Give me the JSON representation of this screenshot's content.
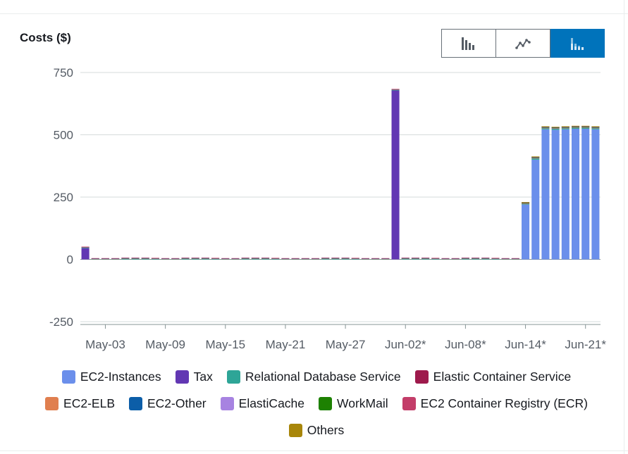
{
  "panel": {
    "title": "Costs ($)",
    "view_buttons": [
      {
        "icon": "bar-chart-icon",
        "active": false
      },
      {
        "icon": "line-chart-icon",
        "active": false
      },
      {
        "icon": "stacked-bar-chart-icon",
        "active": true
      }
    ]
  },
  "chart_data": {
    "type": "bar",
    "stacked": true,
    "title": "",
    "xlabel": "",
    "ylabel": "Costs ($)",
    "ylim": [
      -250,
      750
    ],
    "yticks": [
      750,
      500,
      250,
      0,
      -250
    ],
    "grid": true,
    "legend_position": "bottom",
    "x_tick_labels": [
      "May-03",
      "May-09",
      "May-15",
      "May-21",
      "May-27",
      "Jun-02*",
      "Jun-08*",
      "Jun-14*",
      "Jun-21*"
    ],
    "x_tick_day_index": [
      2,
      8,
      14,
      20,
      26,
      32,
      38,
      44,
      50
    ],
    "categories": [
      "May-01",
      "May-02",
      "May-03",
      "May-04",
      "May-05",
      "May-06",
      "May-07",
      "May-08",
      "May-09",
      "May-10",
      "May-11",
      "May-12",
      "May-13",
      "May-14",
      "May-15",
      "May-16",
      "May-17",
      "May-18",
      "May-19",
      "May-20",
      "May-21",
      "May-22",
      "May-23",
      "May-24",
      "May-25",
      "May-26",
      "May-27",
      "May-28",
      "May-29",
      "May-30",
      "May-31",
      "Jun-01",
      "Jun-02",
      "Jun-03",
      "Jun-04",
      "Jun-05",
      "Jun-06",
      "Jun-07",
      "Jun-08",
      "Jun-09",
      "Jun-10",
      "Jun-11",
      "Jun-12",
      "Jun-13",
      "Jun-14",
      "Jun-15",
      "Jun-16",
      "Jun-17",
      "Jun-18",
      "Jun-19",
      "Jun-20",
      "Jun-21"
    ],
    "series": [
      {
        "name": "EC2-Instances",
        "color": "#6b8feb",
        "values": [
          0,
          0,
          0,
          0,
          0,
          0,
          0,
          0,
          0,
          0,
          0,
          0,
          0,
          0,
          0,
          0,
          0,
          0,
          0,
          0,
          0,
          0,
          0,
          0,
          0,
          0,
          0,
          0,
          0,
          0,
          0,
          0,
          0,
          0,
          0,
          0,
          0,
          0,
          0,
          0,
          0,
          0,
          0,
          0,
          220,
          400,
          522,
          520,
          522,
          524,
          524,
          522
        ]
      },
      {
        "name": "Tax",
        "color": "#6237b3",
        "values": [
          45,
          0,
          0,
          0,
          0,
          0,
          0,
          0,
          0,
          0,
          0,
          0,
          0,
          0,
          0,
          0,
          0,
          0,
          0,
          0,
          0,
          0,
          0,
          0,
          0,
          0,
          0,
          0,
          0,
          0,
          0,
          678,
          0,
          0,
          0,
          0,
          0,
          0,
          0,
          0,
          0,
          0,
          0,
          0,
          0,
          0,
          0,
          0,
          0,
          0,
          0,
          0
        ]
      },
      {
        "name": "Relational Database Service",
        "color": "#2ea597",
        "values": [
          3,
          2,
          2,
          2,
          4,
          4,
          4,
          3,
          2,
          2,
          4,
          4,
          4,
          3,
          2,
          2,
          4,
          4,
          4,
          3,
          2,
          2,
          2,
          2,
          4,
          4,
          4,
          3,
          2,
          2,
          2,
          3,
          4,
          4,
          4,
          3,
          2,
          2,
          4,
          4,
          4,
          3,
          2,
          2,
          4,
          6,
          5,
          5,
          5,
          5,
          5,
          5
        ]
      },
      {
        "name": "Elastic Container Service",
        "color": "#9e1a4c",
        "values": [
          0,
          0,
          0,
          0,
          0,
          0,
          0,
          0,
          0,
          0,
          0,
          0,
          0,
          0,
          0,
          0,
          0,
          0,
          0,
          0,
          0,
          0,
          0,
          0,
          0,
          0,
          0,
          0,
          0,
          0,
          0,
          0,
          0,
          0,
          0,
          0,
          0,
          0,
          0,
          0,
          0,
          0,
          0,
          0,
          0,
          0,
          0,
          0,
          0,
          0,
          0,
          0
        ]
      },
      {
        "name": "EC2-ELB",
        "color": "#e07f4f",
        "values": [
          1,
          1,
          1,
          1,
          1,
          1,
          1,
          1,
          1,
          1,
          1,
          1,
          1,
          1,
          1,
          1,
          1,
          1,
          1,
          1,
          1,
          1,
          1,
          1,
          1,
          1,
          1,
          1,
          1,
          1,
          1,
          1,
          1,
          1,
          1,
          1,
          1,
          1,
          1,
          1,
          1,
          1,
          1,
          1,
          1,
          1,
          1,
          1,
          1,
          1,
          1,
          1
        ]
      },
      {
        "name": "EC2-Other",
        "color": "#0c5ea8",
        "values": [
          1,
          1,
          1,
          1,
          1,
          1,
          1,
          1,
          1,
          1,
          1,
          1,
          1,
          1,
          1,
          1,
          1,
          1,
          1,
          1,
          1,
          1,
          1,
          1,
          1,
          1,
          1,
          1,
          1,
          1,
          1,
          1,
          1,
          1,
          1,
          1,
          1,
          1,
          1,
          1,
          1,
          1,
          1,
          1,
          2,
          3,
          3,
          3,
          3,
          3,
          3,
          3
        ]
      },
      {
        "name": "ElastiCache",
        "color": "#a783e1",
        "values": [
          0,
          0,
          0,
          0,
          0,
          0,
          0,
          0,
          0,
          0,
          0,
          0,
          0,
          0,
          0,
          0,
          0,
          0,
          0,
          0,
          0,
          0,
          0,
          0,
          0,
          0,
          0,
          0,
          0,
          0,
          0,
          0,
          0,
          0,
          0,
          0,
          0,
          0,
          0,
          0,
          0,
          0,
          0,
          0,
          0,
          0,
          0,
          0,
          0,
          0,
          0,
          0
        ]
      },
      {
        "name": "WorkMail",
        "color": "#1d8102",
        "values": [
          0,
          0,
          0,
          0,
          0,
          0,
          0,
          0,
          0,
          0,
          0,
          0,
          0,
          0,
          0,
          0,
          0,
          0,
          0,
          0,
          0,
          0,
          0,
          0,
          0,
          0,
          0,
          0,
          0,
          0,
          0,
          0,
          0,
          0,
          0,
          0,
          0,
          0,
          0,
          0,
          0,
          0,
          0,
          0,
          1,
          1,
          1,
          1,
          1,
          1,
          1,
          1
        ]
      },
      {
        "name": "EC2 Container Registry (ECR)",
        "color": "#c33d69",
        "values": [
          1,
          1,
          1,
          1,
          1,
          1,
          1,
          1,
          1,
          1,
          1,
          1,
          1,
          1,
          1,
          1,
          1,
          1,
          1,
          1,
          1,
          1,
          1,
          1,
          1,
          1,
          1,
          1,
          1,
          1,
          1,
          1,
          1,
          1,
          1,
          1,
          1,
          1,
          1,
          1,
          1,
          1,
          1,
          1,
          1,
          1,
          1,
          1,
          1,
          1,
          1,
          1
        ]
      },
      {
        "name": "Others",
        "color": "#a8860a",
        "values": [
          0,
          0,
          0,
          0,
          0,
          0,
          0,
          0,
          0,
          0,
          0,
          0,
          0,
          0,
          0,
          0,
          0,
          0,
          0,
          0,
          0,
          0,
          0,
          0,
          0,
          0,
          0,
          0,
          0,
          0,
          0,
          0,
          0,
          0,
          0,
          0,
          0,
          0,
          0,
          0,
          0,
          0,
          0,
          0,
          1,
          1,
          1,
          1,
          1,
          1,
          1,
          1
        ]
      }
    ]
  }
}
